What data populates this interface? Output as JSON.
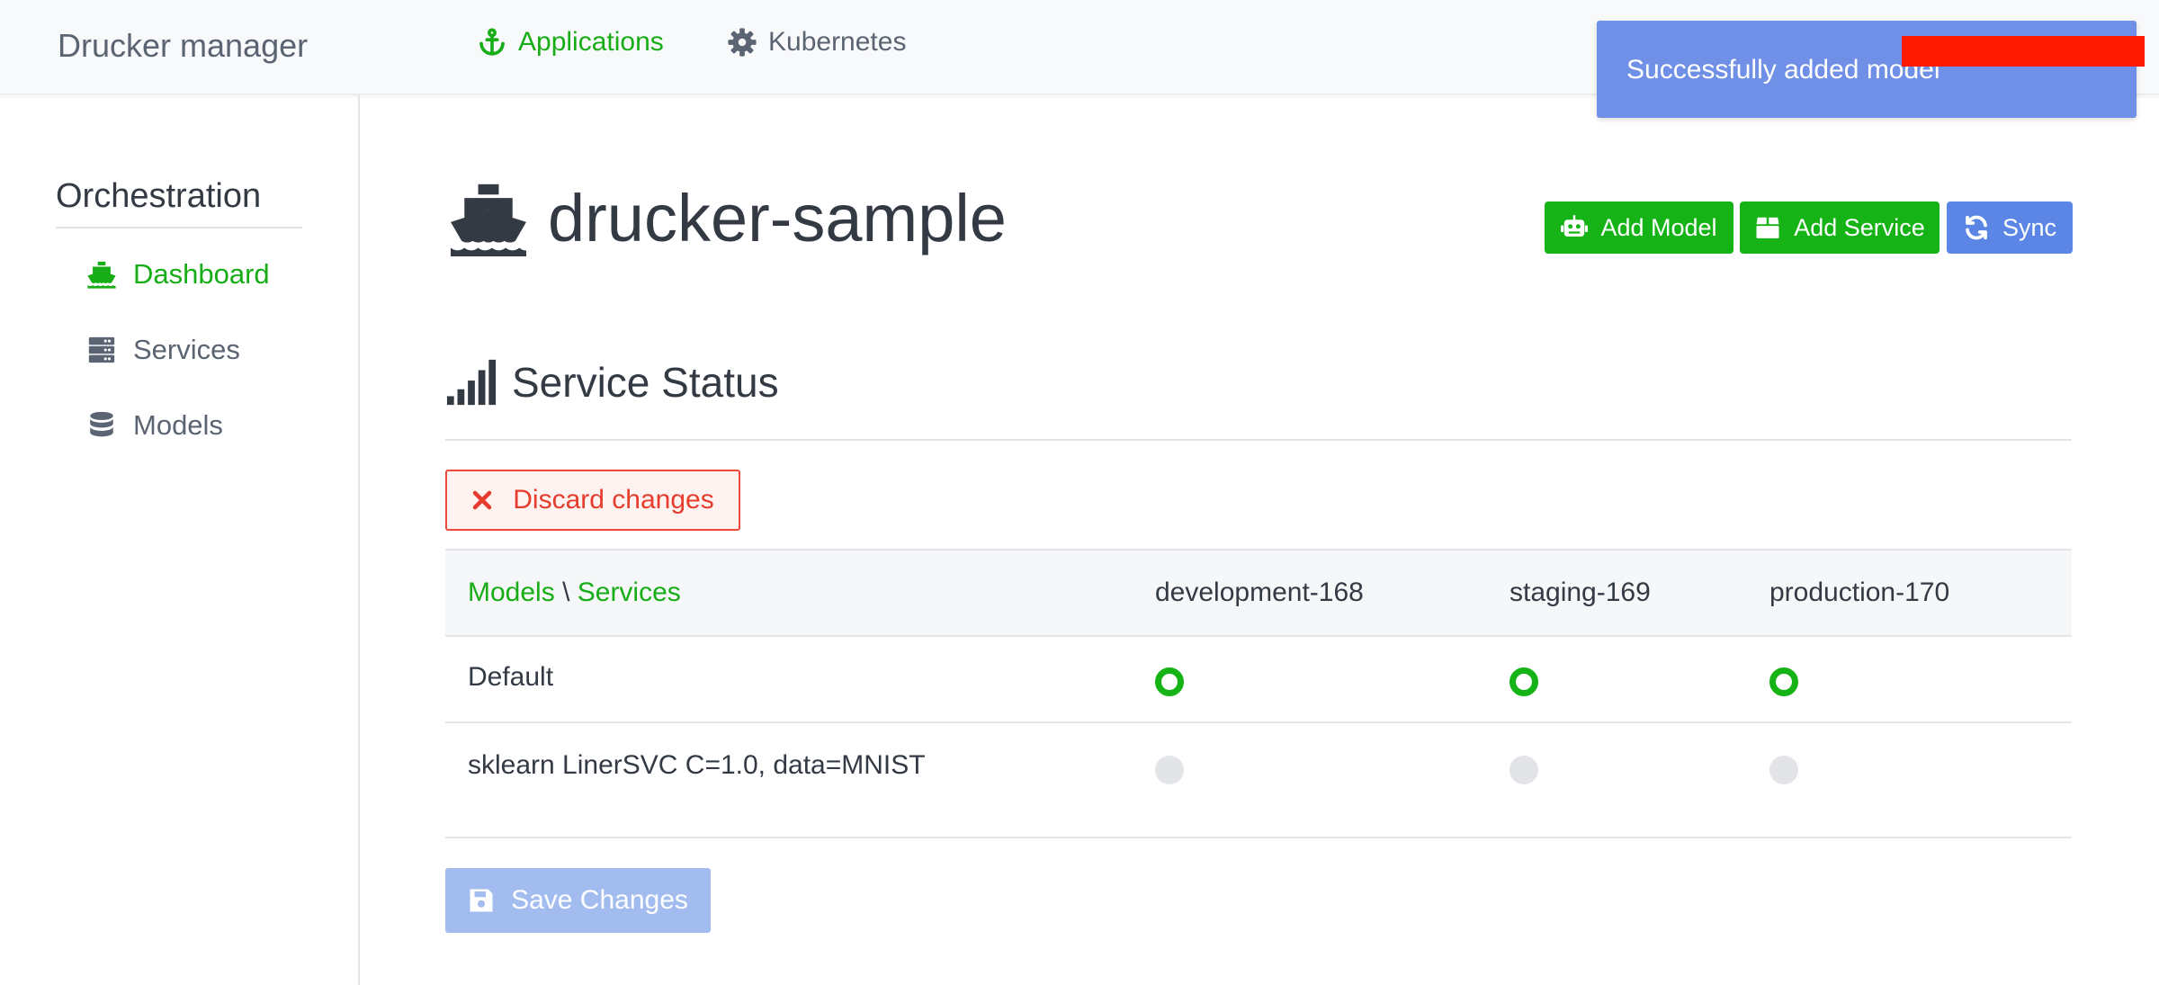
{
  "navbar": {
    "brand": "Drucker manager",
    "links": [
      {
        "label": "Applications",
        "icon": "anchor-icon"
      },
      {
        "label": "Kubernetes",
        "icon": "gear-icon"
      }
    ]
  },
  "sidebar": {
    "title": "Orchestration",
    "items": [
      {
        "label": "Dashboard",
        "icon": "ship-icon",
        "active": true
      },
      {
        "label": "Services",
        "icon": "server-icon"
      },
      {
        "label": "Models",
        "icon": "database-icon"
      }
    ]
  },
  "page": {
    "title": "drucker-sample",
    "icon": "ship-icon",
    "buttons": {
      "add_model": "Add Model",
      "add_service": "Add Service",
      "sync": "Sync"
    }
  },
  "section": {
    "title": "Service Status",
    "icon": "signal-icon",
    "discard_label": "Discard changes",
    "save_label": "Save Changes"
  },
  "table": {
    "corner_models": "Models",
    "corner_sep": "\\",
    "corner_services": "Services",
    "columns": [
      "development-168",
      "staging-169",
      "production-170"
    ],
    "rows": [
      {
        "name": "Default",
        "deployed": [
          true,
          true,
          true
        ]
      },
      {
        "name": "sklearn LinerSVC C=1.0, data=MNIST",
        "deployed": [
          false,
          false,
          false
        ]
      }
    ]
  },
  "toast": {
    "message": "Successfully added model"
  },
  "colors": {
    "accent_green": "#16b316",
    "primary_blue": "#5b86e5",
    "danger_red": "#e53c2c",
    "toast_blue": "#6f90e6"
  }
}
